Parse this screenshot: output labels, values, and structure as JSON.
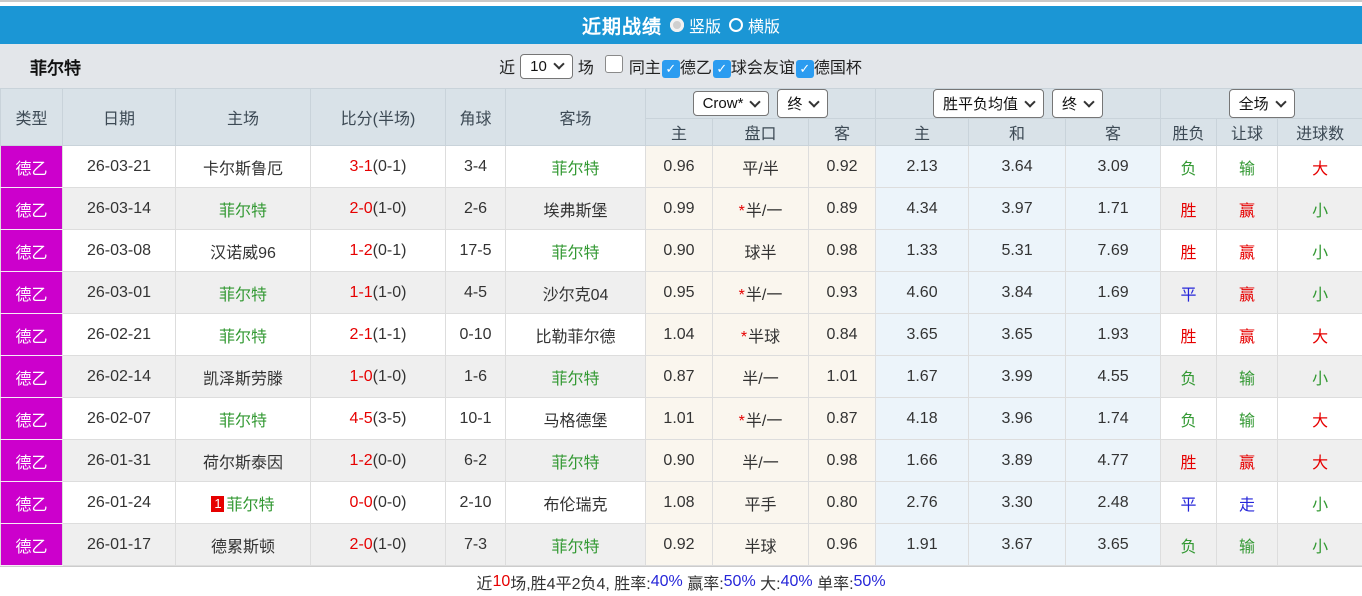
{
  "title_bar": {
    "title": "近期战绩",
    "radio_vertical": "竖版",
    "radio_horizontal": "横版",
    "selected": "竖版"
  },
  "filter_bar": {
    "team": "菲尔特",
    "near_label": "近",
    "near_value": "10",
    "games_label": "场",
    "checkboxes": [
      {
        "label": "同主",
        "checked": false
      },
      {
        "label": "德乙",
        "checked": true
      },
      {
        "label": "球会友谊",
        "checked": true
      },
      {
        "label": "德国杯",
        "checked": true
      }
    ]
  },
  "table": {
    "selects": {
      "odds_company": "Crow*",
      "odds_time": "终",
      "avg_label": "胜平负均值",
      "avg_time": "终",
      "scope": "全场"
    },
    "headers_left": [
      "类型",
      "日期",
      "主场",
      "比分(半场)",
      "角球",
      "客场"
    ],
    "headers_sub": [
      "主",
      "盘口",
      "客",
      "主",
      "和",
      "客",
      "胜负",
      "让球",
      "进球数"
    ],
    "rows": [
      {
        "type": "德乙",
        "date": "26-03-21",
        "home": "卡尔斯鲁厄",
        "home_highlight": false,
        "home_badge": "",
        "score": "3-1",
        "half": "(0-1)",
        "corners": "3-4",
        "away": "菲尔特",
        "away_highlight": true,
        "odds_home": "0.96",
        "handicap_star": false,
        "handicap": "平/半",
        "odds_away": "0.92",
        "avg_home": "2.13",
        "avg_draw": "3.64",
        "avg_away": "3.09",
        "result": {
          "text": "负",
          "color": "green"
        },
        "handicap_result": {
          "text": "输",
          "color": "green"
        },
        "goals": {
          "text": "大",
          "color": "red"
        }
      },
      {
        "type": "德乙",
        "date": "26-03-14",
        "home": "菲尔特",
        "home_highlight": true,
        "home_badge": "",
        "score": "2-0",
        "half": "(1-0)",
        "corners": "2-6",
        "away": "埃弗斯堡",
        "away_highlight": false,
        "odds_home": "0.99",
        "handicap_star": true,
        "handicap": "半/一",
        "odds_away": "0.89",
        "avg_home": "4.34",
        "avg_draw": "3.97",
        "avg_away": "1.71",
        "result": {
          "text": "胜",
          "color": "red"
        },
        "handicap_result": {
          "text": "赢",
          "color": "red"
        },
        "goals": {
          "text": "小",
          "color": "green"
        }
      },
      {
        "type": "德乙",
        "date": "26-03-08",
        "home": "汉诺威96",
        "home_highlight": false,
        "home_badge": "",
        "score": "1-2",
        "half": "(0-1)",
        "corners": "17-5",
        "away": "菲尔特",
        "away_highlight": true,
        "odds_home": "0.90",
        "handicap_star": false,
        "handicap": "球半",
        "odds_away": "0.98",
        "avg_home": "1.33",
        "avg_draw": "5.31",
        "avg_away": "7.69",
        "result": {
          "text": "胜",
          "color": "red"
        },
        "handicap_result": {
          "text": "赢",
          "color": "red"
        },
        "goals": {
          "text": "小",
          "color": "green"
        }
      },
      {
        "type": "德乙",
        "date": "26-03-01",
        "home": "菲尔特",
        "home_highlight": true,
        "home_badge": "",
        "score": "1-1",
        "half": "(1-0)",
        "corners": "4-5",
        "away": "沙尔克04",
        "away_highlight": false,
        "odds_home": "0.95",
        "handicap_star": true,
        "handicap": "半/一",
        "odds_away": "0.93",
        "avg_home": "4.60",
        "avg_draw": "3.84",
        "avg_away": "1.69",
        "result": {
          "text": "平",
          "color": "blue"
        },
        "handicap_result": {
          "text": "赢",
          "color": "red"
        },
        "goals": {
          "text": "小",
          "color": "green"
        }
      },
      {
        "type": "德乙",
        "date": "26-02-21",
        "home": "菲尔特",
        "home_highlight": true,
        "home_badge": "",
        "score": "2-1",
        "half": "(1-1)",
        "corners": "0-10",
        "away": "比勒菲尔德",
        "away_highlight": false,
        "odds_home": "1.04",
        "handicap_star": true,
        "handicap": "半球",
        "odds_away": "0.84",
        "avg_home": "3.65",
        "avg_draw": "3.65",
        "avg_away": "1.93",
        "result": {
          "text": "胜",
          "color": "red"
        },
        "handicap_result": {
          "text": "赢",
          "color": "red"
        },
        "goals": {
          "text": "大",
          "color": "red"
        }
      },
      {
        "type": "德乙",
        "date": "26-02-14",
        "home": "凯泽斯劳滕",
        "home_highlight": false,
        "home_badge": "",
        "score": "1-0",
        "half": "(1-0)",
        "corners": "1-6",
        "away": "菲尔特",
        "away_highlight": true,
        "odds_home": "0.87",
        "handicap_star": false,
        "handicap": "半/一",
        "odds_away": "1.01",
        "avg_home": "1.67",
        "avg_draw": "3.99",
        "avg_away": "4.55",
        "result": {
          "text": "负",
          "color": "green"
        },
        "handicap_result": {
          "text": "输",
          "color": "green"
        },
        "goals": {
          "text": "小",
          "color": "green"
        }
      },
      {
        "type": "德乙",
        "date": "26-02-07",
        "home": "菲尔特",
        "home_highlight": true,
        "home_badge": "",
        "score": "4-5",
        "half": "(3-5)",
        "corners": "10-1",
        "away": "马格德堡",
        "away_highlight": false,
        "odds_home": "1.01",
        "handicap_star": true,
        "handicap": "半/一",
        "odds_away": "0.87",
        "avg_home": "4.18",
        "avg_draw": "3.96",
        "avg_away": "1.74",
        "result": {
          "text": "负",
          "color": "green"
        },
        "handicap_result": {
          "text": "输",
          "color": "green"
        },
        "goals": {
          "text": "大",
          "color": "red"
        }
      },
      {
        "type": "德乙",
        "date": "26-01-31",
        "home": "荷尔斯泰因",
        "home_highlight": false,
        "home_badge": "",
        "score": "1-2",
        "half": "(0-0)",
        "corners": "6-2",
        "away": "菲尔特",
        "away_highlight": true,
        "odds_home": "0.90",
        "handicap_star": false,
        "handicap": "半/一",
        "odds_away": "0.98",
        "avg_home": "1.66",
        "avg_draw": "3.89",
        "avg_away": "4.77",
        "result": {
          "text": "胜",
          "color": "red"
        },
        "handicap_result": {
          "text": "赢",
          "color": "red"
        },
        "goals": {
          "text": "大",
          "color": "red"
        }
      },
      {
        "type": "德乙",
        "date": "26-01-24",
        "home": "菲尔特",
        "home_highlight": true,
        "home_badge": "1",
        "score": "0-0",
        "half": "(0-0)",
        "corners": "2-10",
        "away": "布伦瑞克",
        "away_highlight": false,
        "odds_home": "1.08",
        "handicap_star": false,
        "handicap": "平手",
        "odds_away": "0.80",
        "avg_home": "2.76",
        "avg_draw": "3.30",
        "avg_away": "2.48",
        "result": {
          "text": "平",
          "color": "blue"
        },
        "handicap_result": {
          "text": "走",
          "color": "blue"
        },
        "goals": {
          "text": "小",
          "color": "green"
        }
      },
      {
        "type": "德乙",
        "date": "26-01-17",
        "home": "德累斯顿",
        "home_highlight": false,
        "home_badge": "",
        "score": "2-0",
        "half": "(1-0)",
        "corners": "7-3",
        "away": "菲尔特",
        "away_highlight": true,
        "odds_home": "0.92",
        "handicap_star": false,
        "handicap": "半球",
        "odds_away": "0.96",
        "avg_home": "1.91",
        "avg_draw": "3.67",
        "avg_away": "3.65",
        "result": {
          "text": "负",
          "color": "green"
        },
        "handicap_result": {
          "text": "输",
          "color": "green"
        },
        "goals": {
          "text": "小",
          "color": "green"
        }
      }
    ]
  },
  "footer": {
    "segments": [
      {
        "text": "近",
        "color": "black"
      },
      {
        "text": "10",
        "color": "red"
      },
      {
        "text": "场,胜4平2负4, 胜率:",
        "color": "black"
      },
      {
        "text": "40%",
        "color": "blue"
      },
      {
        "text": " 赢率:",
        "color": "black"
      },
      {
        "text": "50%",
        "color": "blue"
      },
      {
        "text": " 大:",
        "color": "black"
      },
      {
        "text": "40%",
        "color": "blue"
      },
      {
        "text": " 单率:",
        "color": "black"
      },
      {
        "text": "50%",
        "color": "blue"
      }
    ]
  },
  "colors": {
    "accent_blue": "#1b96d5",
    "type_magenta": "#cc00cc",
    "win_red": "#e60000",
    "lose_green": "#339933",
    "draw_blue": "#2626d9",
    "odds_bg": "#faf6ee",
    "avg_bg": "#ecf4fa",
    "header_bg": "#d9e2e8"
  }
}
